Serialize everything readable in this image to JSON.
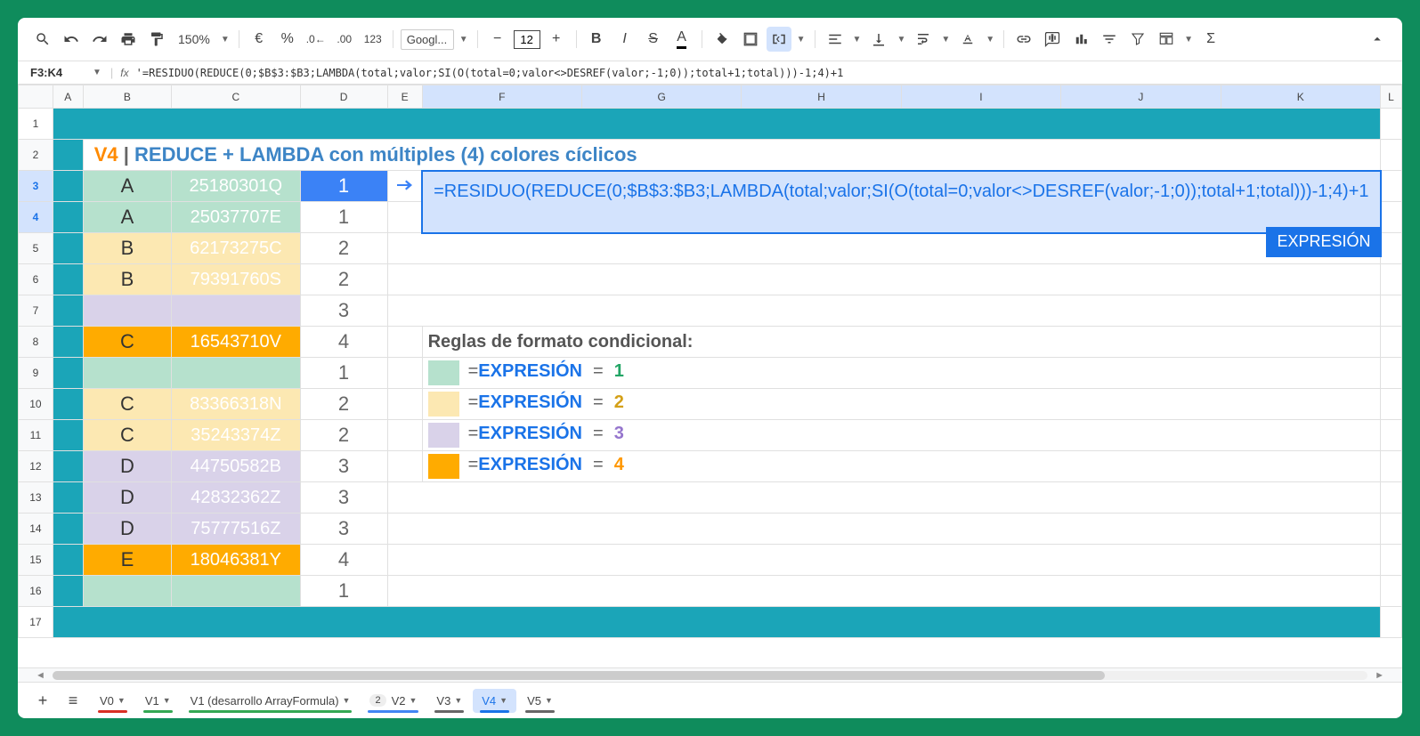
{
  "toolbar": {
    "zoom": "150%",
    "font": "Googl...",
    "size": "12",
    "fmt123": "123"
  },
  "nameBox": "F3:K4",
  "formulaBar": "'=RESIDUO(REDUCE(0;$B$3:$B3;LAMBDA(total;valor;SI(O(total=0;valor<>DESREF(valor;-1;0));total+1;total)))-1;4)+1",
  "cols": [
    "A",
    "B",
    "C",
    "D",
    "E",
    "F",
    "G",
    "H",
    "I",
    "J",
    "K",
    "L"
  ],
  "title": {
    "v": "V4",
    "sep": " | ",
    "rest": "REDUCE + LAMBDA con múltiples (4) colores cíclicos"
  },
  "rows": [
    {
      "n": 3,
      "b": "A",
      "c": "25180301Q",
      "d": "1",
      "bg": "bg-green",
      "dsel": true
    },
    {
      "n": 4,
      "b": "A",
      "c": "25037707E",
      "d": "1",
      "bg": "bg-green"
    },
    {
      "n": 5,
      "b": "B",
      "c": "62173275C",
      "d": "2",
      "bg": "bg-yellow"
    },
    {
      "n": 6,
      "b": "B",
      "c": "79391760S",
      "d": "2",
      "bg": "bg-yellow"
    },
    {
      "n": 7,
      "b": "",
      "c": "",
      "d": "3",
      "bg": "bg-purple"
    },
    {
      "n": 8,
      "b": "C",
      "c": "16543710V",
      "d": "4",
      "bg": "bg-orange2"
    },
    {
      "n": 9,
      "b": "",
      "c": "",
      "d": "1",
      "bg": "bg-green"
    },
    {
      "n": 10,
      "b": "C",
      "c": "83366318N",
      "d": "2",
      "bg": "bg-yellow"
    },
    {
      "n": 11,
      "b": "C",
      "c": "35243374Z",
      "d": "2",
      "bg": "bg-yellow"
    },
    {
      "n": 12,
      "b": "D",
      "c": "44750582B",
      "d": "3",
      "bg": "bg-purple"
    },
    {
      "n": 13,
      "b": "D",
      "c": "42832362Z",
      "d": "3",
      "bg": "bg-purple"
    },
    {
      "n": 14,
      "b": "D",
      "c": "75777516Z",
      "d": "3",
      "bg": "bg-purple"
    },
    {
      "n": 15,
      "b": "E",
      "c": "18046381Y",
      "d": "4",
      "bg": "bg-orange2"
    },
    {
      "n": 16,
      "b": "",
      "c": "",
      "d": "1",
      "bg": "bg-green"
    }
  ],
  "bigFormula": "=RESIDUO(REDUCE(0;$B$3:$B3;LAMBDA(total;valor;SI(O(total=0;valor<>DESREF(valor;-1;0));total+1;total)))-1;4)+1",
  "exprLabel": "EXPRESIÓN",
  "rulesHeader": "Reglas de formato condicional:",
  "rules": [
    {
      "swatch": "bg-green",
      "num": "1",
      "ncls": "n1"
    },
    {
      "swatch": "bg-yellow",
      "num": "2",
      "ncls": "n2"
    },
    {
      "swatch": "bg-purple",
      "num": "3",
      "ncls": "n3"
    },
    {
      "swatch": "bg-orange2",
      "num": "4",
      "ncls": "n4"
    }
  ],
  "ruleExpr": "EXPRESIÓN",
  "tabs": [
    {
      "label": "V0",
      "bar": "#d93025"
    },
    {
      "label": "V1",
      "bar": "#34a853"
    },
    {
      "label": "V1 (desarrollo ArrayFormula)",
      "bar": "#34a853"
    },
    {
      "label": "V2",
      "bar": "#4285f4",
      "badge": "2"
    },
    {
      "label": "V3",
      "bar": "#666"
    },
    {
      "label": "V4",
      "bar": "#1a73e8",
      "active": true
    },
    {
      "label": "V5",
      "bar": "#666"
    }
  ]
}
